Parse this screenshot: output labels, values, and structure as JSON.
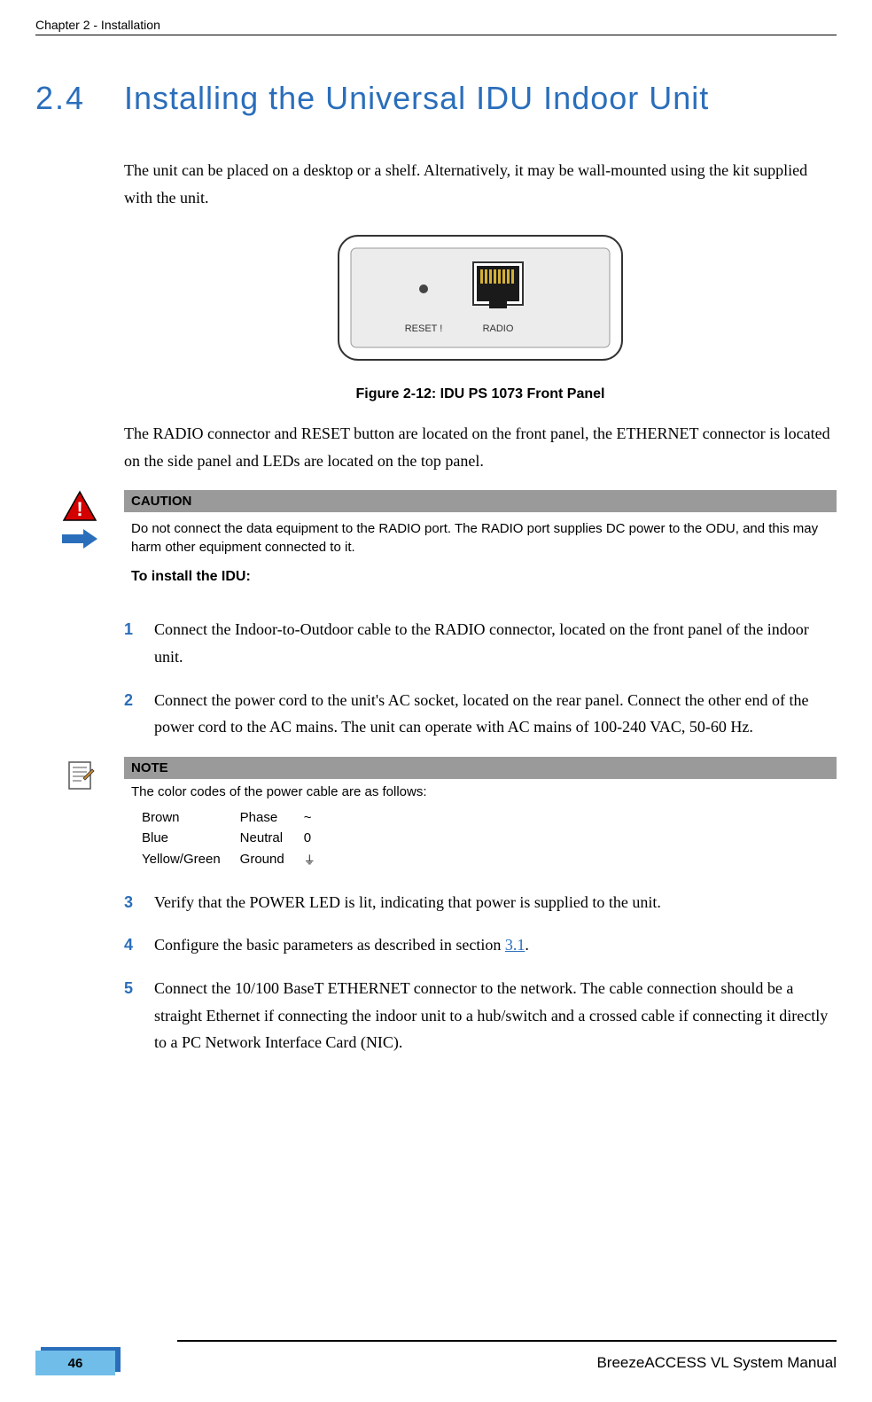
{
  "header": {
    "chapter": "Chapter 2 - Installation"
  },
  "section": {
    "number": "2.4",
    "title": "Installing the Universal IDU Indoor Unit"
  },
  "intro": "The unit can be placed on a desktop or a shelf. Alternatively, it may be wall-mounted using the kit supplied with the unit.",
  "figure": {
    "labels": {
      "reset": "RESET !",
      "radio": "RADIO"
    },
    "caption": "Figure 2-12: IDU PS 1073 Front Panel"
  },
  "para2": "The RADIO connector and RESET button are located on the front panel, the ETHERNET connector is located on the side panel and LEDs are located on the top panel.",
  "caution": {
    "header": "CAUTION",
    "text": "Do not connect the data equipment to the RADIO port. The RADIO port supplies DC power to the ODU, and this may harm other equipment connected to it."
  },
  "to_install_heading": "To install the IDU:",
  "steps": {
    "s1": {
      "num": "1",
      "text": "Connect the Indoor-to-Outdoor cable to the RADIO connector, located on the front panel of the indoor unit."
    },
    "s2": {
      "num": "2",
      "text": "Connect the power cord to the unit's AC socket, located on the rear panel. Connect the other end of the power cord to the AC mains. The unit can operate with AC mains of 100-240 VAC, 50-60 Hz."
    },
    "s3": {
      "num": "3",
      "text": "Verify that the POWER LED is lit, indicating that power is supplied to the unit."
    },
    "s4": {
      "num": "4",
      "text_pre": "Configure the basic parameters as described in section ",
      "link": "3.1",
      "text_post": "."
    },
    "s5": {
      "num": "5",
      "text": "Connect the 10/100 BaseT ETHERNET connector to the network. The cable connection should be a straight Ethernet if connecting the indoor unit to a hub/switch and a crossed cable if connecting it directly to a PC Network Interface Card (NIC)."
    }
  },
  "note": {
    "header": "NOTE",
    "intro": "The color codes of the power cable are as follows:",
    "rows": [
      {
        "color": "Brown",
        "role": "Phase",
        "sym": "~"
      },
      {
        "color": "Blue",
        "role": "Neutral",
        "sym": "0"
      },
      {
        "color": "Yellow/Green",
        "role": "Ground",
        "sym": "⏚"
      }
    ]
  },
  "footer": {
    "page": "46",
    "manual": "BreezeACCESS VL System Manual"
  },
  "chart_data": null
}
